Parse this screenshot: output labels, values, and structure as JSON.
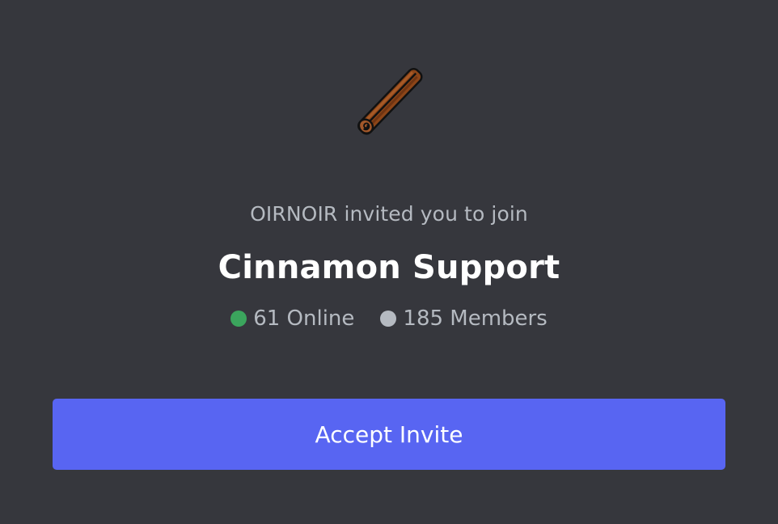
{
  "invite": {
    "inviter_text": "OIRNOIR invited you to join",
    "server_name": "Cinnamon Support",
    "online_text": "61 Online",
    "members_text": "185 Members",
    "accept_label": "Accept Invite"
  },
  "icons": {
    "server_icon": "cinnamon-stick-icon",
    "online_indicator": "online-dot-icon",
    "members_indicator": "members-dot-icon"
  },
  "colors": {
    "background": "#36373d",
    "accent": "#5865f2",
    "online": "#3ba55d",
    "muted_text": "#b5bac1",
    "title_text": "#ffffff"
  }
}
